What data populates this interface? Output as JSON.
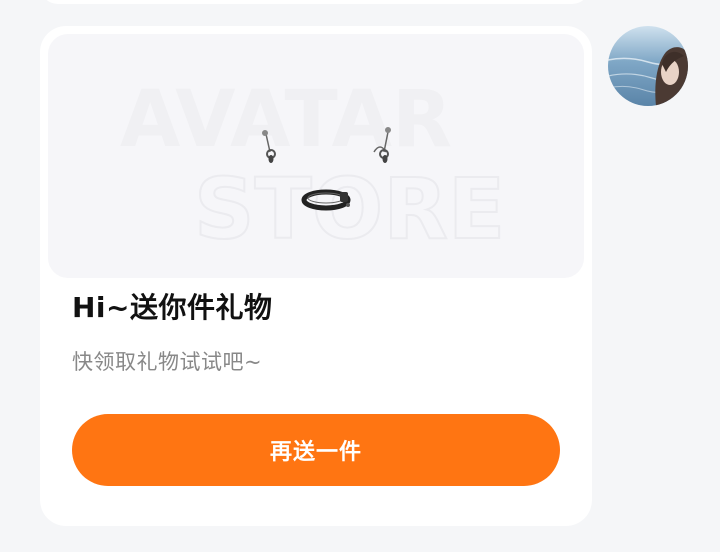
{
  "card": {
    "image_alt": "AVATAR STORE",
    "watermark_top": "AVATAR",
    "watermark_bottom": "STORE",
    "title": "Hi~送你件礼物",
    "subtitle": "快领取礼物试试吧~",
    "button_label": "再送一件"
  },
  "avatar": {
    "alt": "user-avatar"
  },
  "colors": {
    "page_background": "#f5f6f8",
    "card_background": "#ffffff",
    "button_background": "#ff7512",
    "title_text": "#111111",
    "subtitle_text": "#888888"
  }
}
